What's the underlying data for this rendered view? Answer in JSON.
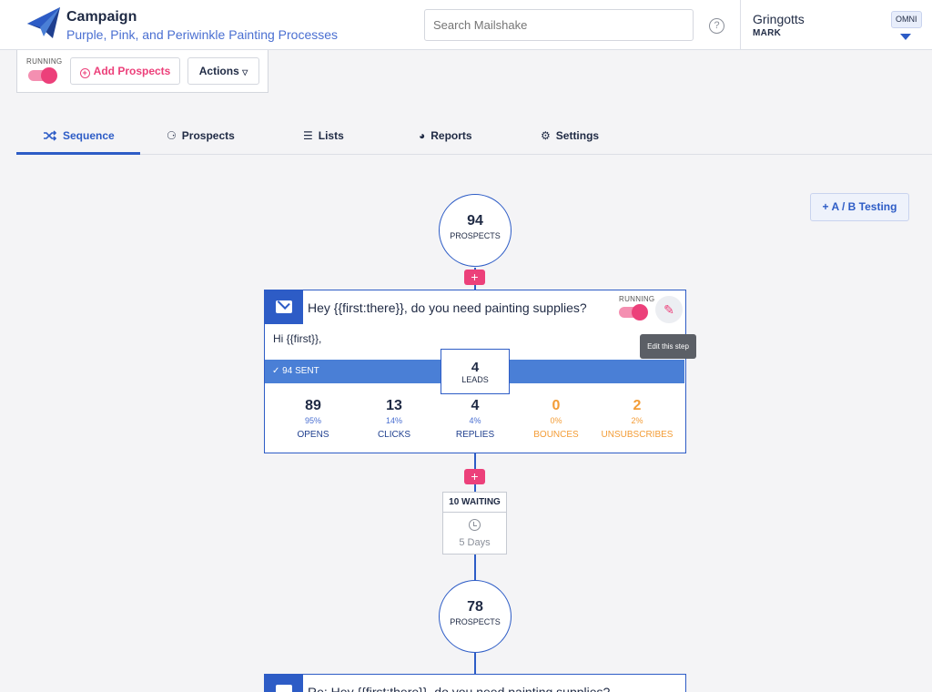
{
  "header": {
    "title": "Campaign",
    "subtitle": "Purple, Pink, and Periwinkle Painting Processes",
    "search_placeholder": "Search Mailshake",
    "help_glyph": "?",
    "account_name": "Gringotts",
    "account_user": "MARK",
    "account_badge": "OMNI"
  },
  "toolbar": {
    "status_label": "RUNNING",
    "add_prospects": "Add Prospects",
    "actions": "Actions"
  },
  "tabs": [
    {
      "label": "Sequence",
      "icon": "shuffle-icon",
      "active": true
    },
    {
      "label": "Prospects",
      "icon": "people-icon"
    },
    {
      "label": "Lists",
      "icon": "list-icon"
    },
    {
      "label": "Reports",
      "icon": "pie-icon"
    },
    {
      "label": "Settings",
      "icon": "gears-icon"
    }
  ],
  "ab_testing": "+ A / B Testing",
  "flow": {
    "start": {
      "count": "94",
      "label": "PROSPECTS"
    },
    "step1": {
      "subject": "Hey {{first:there}}, do you need painting supplies?",
      "status_label": "RUNNING",
      "body": "Hi {{first}},",
      "sent": "94 SENT",
      "leads": {
        "count": "4",
        "label": "LEADS"
      },
      "stats": [
        {
          "value": "89",
          "pct": "95%",
          "label": "OPENS"
        },
        {
          "value": "13",
          "pct": "14%",
          "label": "CLICKS"
        },
        {
          "value": "4",
          "pct": "4%",
          "label": "REPLIES"
        },
        {
          "value": "0",
          "pct": "0%",
          "label": "BOUNCES"
        },
        {
          "value": "2",
          "pct": "2%",
          "label": "UNSUBSCRIBES"
        }
      ],
      "edit_tooltip": "Edit this step"
    },
    "wait": {
      "waiting": "10 WAITING",
      "days": "5 Days"
    },
    "second": {
      "count": "78",
      "label": "PROSPECTS"
    },
    "step2": {
      "subject": "Re: Hey {{first:there}}, do you need painting supplies?"
    }
  },
  "colors": {
    "accent": "#2d5cc6",
    "pink": "#ec407a",
    "orange": "#f39c36"
  }
}
